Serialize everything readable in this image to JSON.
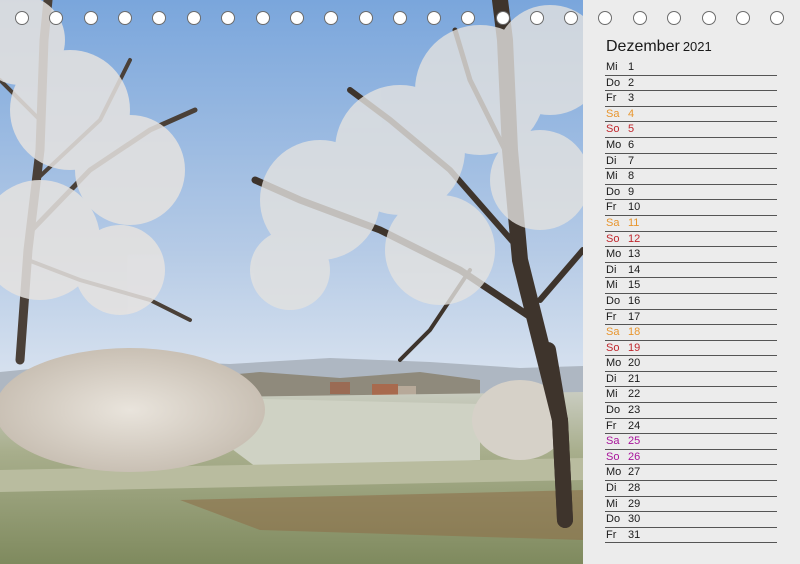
{
  "calendar": {
    "month": "Dezember",
    "year": "2021",
    "colors": {
      "weekday": "#1a1a1a",
      "saturday": "#e8962e",
      "sunday": "#c0272d",
      "holiday": "#a8139b"
    },
    "days": [
      {
        "wd": "Mi",
        "num": "1",
        "type": "weekday"
      },
      {
        "wd": "Do",
        "num": "2",
        "type": "weekday"
      },
      {
        "wd": "Fr",
        "num": "3",
        "type": "weekday"
      },
      {
        "wd": "Sa",
        "num": "4",
        "type": "saturday"
      },
      {
        "wd": "So",
        "num": "5",
        "type": "sunday"
      },
      {
        "wd": "Mo",
        "num": "6",
        "type": "weekday"
      },
      {
        "wd": "Di",
        "num": "7",
        "type": "weekday"
      },
      {
        "wd": "Mi",
        "num": "8",
        "type": "weekday"
      },
      {
        "wd": "Do",
        "num": "9",
        "type": "weekday"
      },
      {
        "wd": "Fr",
        "num": "10",
        "type": "weekday"
      },
      {
        "wd": "Sa",
        "num": "11",
        "type": "saturday"
      },
      {
        "wd": "So",
        "num": "12",
        "type": "sunday"
      },
      {
        "wd": "Mo",
        "num": "13",
        "type": "weekday"
      },
      {
        "wd": "Di",
        "num": "14",
        "type": "weekday"
      },
      {
        "wd": "Mi",
        "num": "15",
        "type": "weekday"
      },
      {
        "wd": "Do",
        "num": "16",
        "type": "weekday"
      },
      {
        "wd": "Fr",
        "num": "17",
        "type": "weekday"
      },
      {
        "wd": "Sa",
        "num": "18",
        "type": "saturday"
      },
      {
        "wd": "So",
        "num": "19",
        "type": "sunday"
      },
      {
        "wd": "Mo",
        "num": "20",
        "type": "weekday"
      },
      {
        "wd": "Di",
        "num": "21",
        "type": "weekday"
      },
      {
        "wd": "Mi",
        "num": "22",
        "type": "weekday"
      },
      {
        "wd": "Do",
        "num": "23",
        "type": "weekday"
      },
      {
        "wd": "Fr",
        "num": "24",
        "type": "weekday"
      },
      {
        "wd": "Sa",
        "num": "25",
        "type": "holiday"
      },
      {
        "wd": "So",
        "num": "26",
        "type": "holiday"
      },
      {
        "wd": "Mo",
        "num": "27",
        "type": "weekday"
      },
      {
        "wd": "Di",
        "num": "28",
        "type": "weekday"
      },
      {
        "wd": "Mi",
        "num": "29",
        "type": "weekday"
      },
      {
        "wd": "Do",
        "num": "30",
        "type": "weekday"
      },
      {
        "wd": "Fr",
        "num": "31",
        "type": "weekday"
      }
    ]
  },
  "photo": {
    "colors": {
      "sky_top": "#7da9dd",
      "sky_bottom": "#dfe8f3",
      "field": "#a9b08c",
      "frost": "#e4e6ea"
    }
  }
}
